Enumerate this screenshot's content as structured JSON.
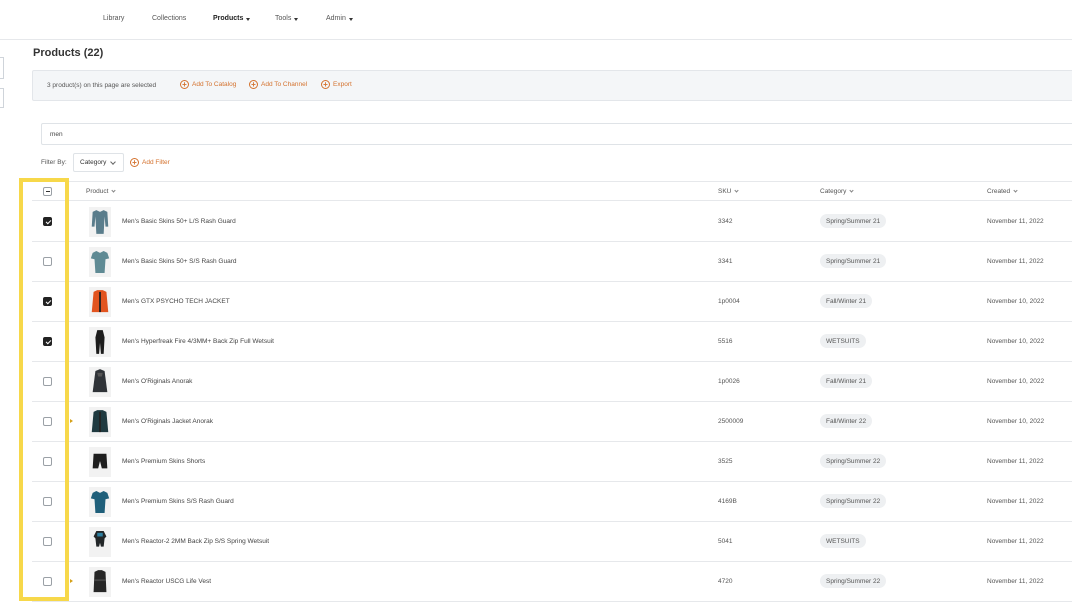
{
  "nav": {
    "items": [
      {
        "label": "Library",
        "active": false,
        "dropdown": false
      },
      {
        "label": "Collections",
        "active": false,
        "dropdown": false
      },
      {
        "label": "Products",
        "active": true,
        "dropdown": true
      },
      {
        "label": "Tools",
        "active": false,
        "dropdown": true
      },
      {
        "label": "Admin",
        "active": false,
        "dropdown": true
      }
    ]
  },
  "page": {
    "title": "Products (22)"
  },
  "selection_bar": {
    "text": "3 product(s) on this page are selected",
    "actions": [
      "Add To Catalog",
      "Add To Channel",
      "Export"
    ]
  },
  "search": {
    "value": "men"
  },
  "filter": {
    "label": "Filter By:",
    "selected": "Category",
    "add_label": "Add Filter"
  },
  "table": {
    "columns": [
      "Product",
      "SKU",
      "Category",
      "Created"
    ],
    "rows": [
      {
        "checked": true,
        "expandable": false,
        "name": "Men's Basic Skins 50+ L/S Rash Guard",
        "sku": "3342",
        "category": "Spring/Summer 21",
        "created": "November 11, 2022",
        "icon": "longsleeve-shirt-icon",
        "color": "#5a7d8c"
      },
      {
        "checked": false,
        "expandable": false,
        "name": "Men's Basic Skins 50+ S/S Rash Guard",
        "sku": "3341",
        "category": "Spring/Summer 21",
        "created": "November 11, 2022",
        "icon": "tshirt-icon",
        "color": "#5f8a94"
      },
      {
        "checked": true,
        "expandable": false,
        "name": "Men's GTX PSYCHO TECH JACKET",
        "sku": "1p0004",
        "category": "Fall/Winter 21",
        "created": "November 10, 2022",
        "icon": "jacket-icon",
        "color": "#e2541f"
      },
      {
        "checked": true,
        "expandable": false,
        "name": "Men's Hyperfreak Fire 4/3MM+ Back Zip Full Wetsuit",
        "sku": "5516",
        "category": "WETSUITS",
        "created": "November 10, 2022",
        "icon": "wetsuit-icon",
        "color": "#1c1c1c"
      },
      {
        "checked": false,
        "expandable": false,
        "name": "Men's O'Riginals Anorak",
        "sku": "1p0026",
        "category": "Fall/Winter 21",
        "created": "November 10, 2022",
        "icon": "anorak-icon",
        "color": "#2f3338"
      },
      {
        "checked": false,
        "expandable": true,
        "name": "Men's O'Riginals Jacket Anorak",
        "sku": "2500009",
        "category": "Fall/Winter 22",
        "created": "November 10, 2022",
        "icon": "jacket-icon",
        "color": "#1f3a40"
      },
      {
        "checked": false,
        "expandable": false,
        "name": "Men's Premium Skins Shorts",
        "sku": "3525",
        "category": "Spring/Summer 22",
        "created": "November 11, 2022",
        "icon": "shorts-icon",
        "color": "#1e1e1e"
      },
      {
        "checked": false,
        "expandable": false,
        "name": "Men's Premium Skins S/S Rash Guard",
        "sku": "4169B",
        "category": "Spring/Summer 22",
        "created": "November 11, 2022",
        "icon": "tshirt-icon",
        "color": "#1f5f7a"
      },
      {
        "checked": false,
        "expandable": false,
        "name": "Men's Reactor-2 2MM Back Zip S/S Spring Wetsuit",
        "sku": "5041",
        "category": "WETSUITS",
        "created": "November 11, 2022",
        "icon": "spring-wetsuit-icon",
        "color": "#222628"
      },
      {
        "checked": false,
        "expandable": true,
        "name": "Men's Reactor USCG Life Vest",
        "sku": "4720",
        "category": "Spring/Summer 22",
        "created": "November 11, 2022",
        "icon": "life-vest-icon",
        "color": "#262626"
      }
    ]
  },
  "colors": {
    "accent": "#d4722e",
    "highlight": "#f7d84a"
  }
}
